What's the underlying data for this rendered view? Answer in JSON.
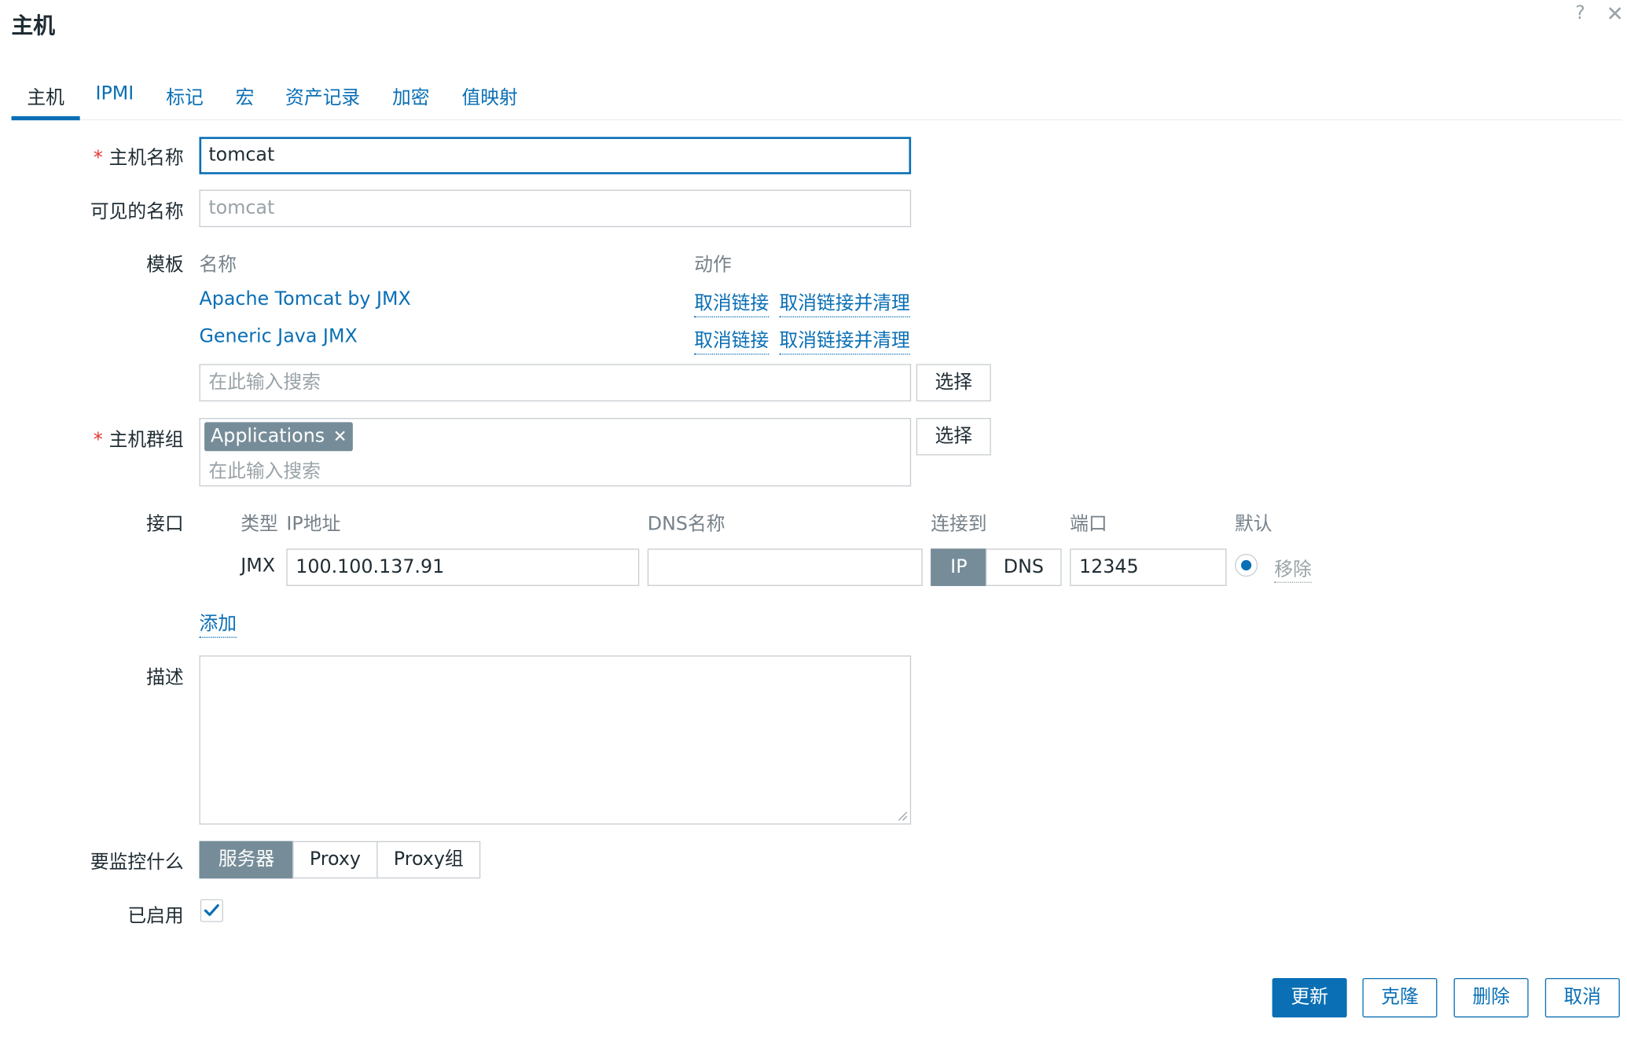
{
  "dialog": {
    "title": "主机",
    "help_icon": "?",
    "close_icon": "✕"
  },
  "tabs": [
    {
      "label": "主机"
    },
    {
      "label": "IPMI"
    },
    {
      "label": "标记"
    },
    {
      "label": "宏"
    },
    {
      "label": "资产记录"
    },
    {
      "label": "加密"
    },
    {
      "label": "值映射"
    }
  ],
  "host_name": {
    "label": "主机名称",
    "value": "tomcat",
    "required": "*"
  },
  "visible_name": {
    "label": "可见的名称",
    "placeholder": "tomcat"
  },
  "templates": {
    "label": "模板",
    "col_name": "名称",
    "col_action": "动作",
    "rows": [
      {
        "name": "Apache Tomcat by JMX",
        "unlink": "取消链接",
        "unlink_clear": "取消链接并清理"
      },
      {
        "name": "Generic Java JMX",
        "unlink": "取消链接",
        "unlink_clear": "取消链接并清理"
      }
    ],
    "search_placeholder": "在此输入搜索",
    "select_label": "选择"
  },
  "host_groups": {
    "label": "主机群组",
    "required": "*",
    "chip": "Applications",
    "chip_remove": "✕",
    "search_placeholder": "在此输入搜索",
    "select_label": "选择"
  },
  "interfaces": {
    "label": "接口",
    "col_type": "类型",
    "col_ip": "IP地址",
    "col_dns": "DNS名称",
    "col_connect": "连接到",
    "col_port": "端口",
    "col_default": "默认",
    "row": {
      "type": "JMX",
      "ip": "100.100.137.91",
      "dns": "",
      "connect_ip": "IP",
      "connect_dns": "DNS",
      "port": "12345",
      "remove": "移除"
    },
    "add": "添加"
  },
  "description": {
    "label": "描述",
    "value": ""
  },
  "monitored_by": {
    "label": "要监控什么",
    "options": [
      "服务器",
      "Proxy",
      "Proxy组"
    ],
    "selected": "服务器"
  },
  "enabled": {
    "label": "已启用",
    "checked": true
  },
  "footer": {
    "update": "更新",
    "clone": "克隆",
    "delete": "删除",
    "cancel": "取消"
  },
  "colors": {
    "accent": "#0a6fb5",
    "toggle_on": "#768d99",
    "required": "#e33734"
  }
}
